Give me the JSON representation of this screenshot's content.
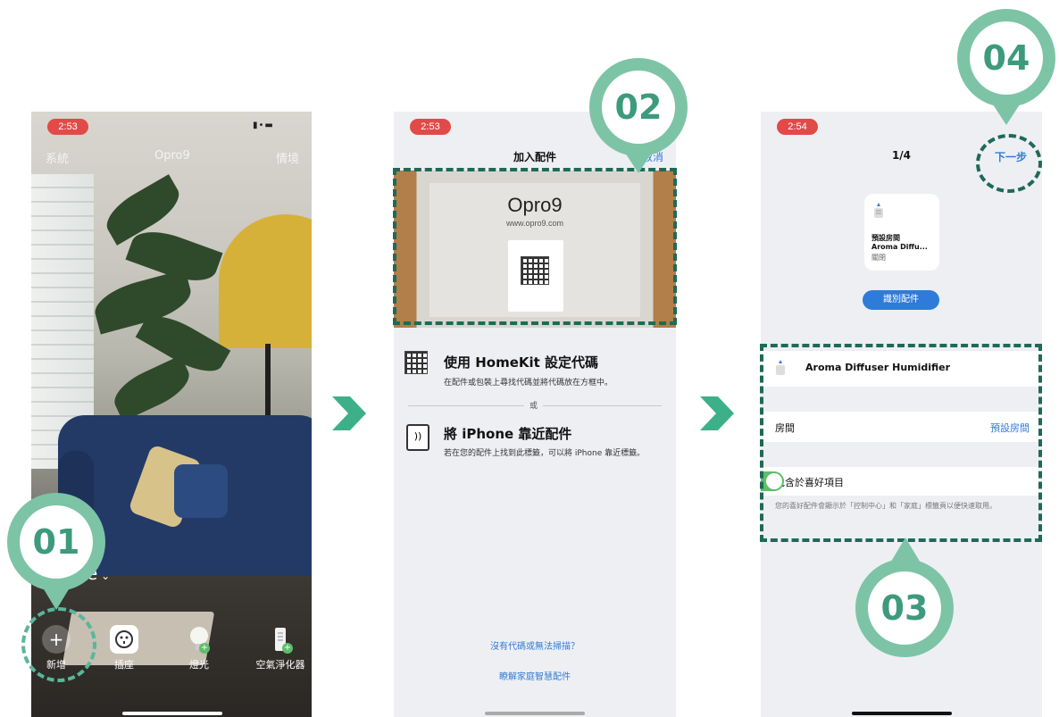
{
  "phone1": {
    "time": "2:53",
    "status_icons": "▮•▬",
    "nav_left": "系統",
    "nav_title": "Opro9",
    "nav_right": "情境",
    "home_suffix": "e",
    "toolbar": [
      {
        "label": "新增",
        "icon": "plus-icon"
      },
      {
        "label": "插座",
        "icon": "outlet-icon"
      },
      {
        "label": "燈光",
        "icon": "lightbulb-icon"
      },
      {
        "label": "空氣淨化器",
        "icon": "air-purifier-icon"
      }
    ]
  },
  "phone2": {
    "time": "2:53",
    "title": "加入配件",
    "cancel": "取消",
    "camera_brand": "Opro9",
    "camera_url": "www.opro9.com",
    "option1_title": "使用 HomeKit 設定代碼",
    "option1_desc": "在配件或包裝上尋找代碼並將代碼放在方框中。",
    "or_label": "或",
    "option2_title": "將 iPhone 靠近配件",
    "option2_desc": "若在您的配件上找到此標籤，可以將 iPhone 靠近標籤。",
    "link1": "沒有代碼或無法掃描？",
    "link2": "瞭解家庭智慧配件"
  },
  "phone3": {
    "time": "2:54",
    "page": "1/4",
    "next": "下一步",
    "card_room": "預設房間",
    "card_name": "Aroma Diffu...",
    "card_state": "關閉",
    "identify_button": "識別配件",
    "accessory_name": "Aroma Diffuser Humidifier",
    "room_label": "房間",
    "room_value": "預設房間",
    "favorite_label": "包含於喜好項目",
    "favorite_on": true,
    "favorite_note": "您的喜好配件會顯示於「控制中心」和「家庭」標籤頁以便快速取用。"
  },
  "markers": [
    "01",
    "02",
    "03",
    "04"
  ],
  "colors": {
    "accent": "#7cc4a5",
    "dark_green": "#1e6a57",
    "blue": "#2f7bd9",
    "red": "#e24a48"
  }
}
